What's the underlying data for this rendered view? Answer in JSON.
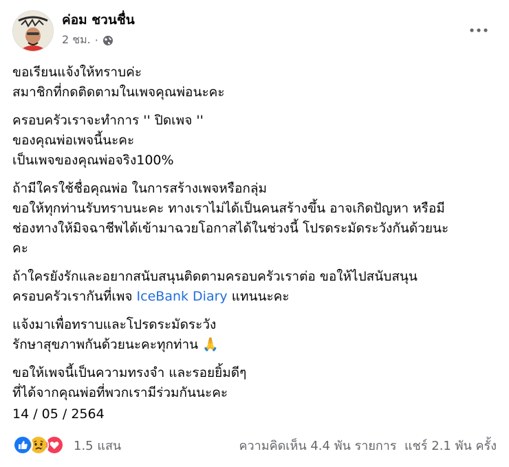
{
  "post": {
    "author": "ค่อม ชวนชื่น",
    "time": "2 ชม.",
    "privacy_icon": "globe-icon",
    "paragraphs": [
      [
        "ขอเรียนแจ้งให้ทราบค่ะ",
        "สมาชิกที่กดติดตามในเพจคุณพ่อนะคะ"
      ],
      [
        "ครอบครัวเราจะทำการ '' ปิดเพจ ''",
        "ของคุณพ่อเพจนี้นะคะ",
        "เป็นเพจของคุณพ่อจริง100%"
      ],
      [
        "ถ้ามีใครใช้ชื่อคุณพ่อ ในการสร้างเพจหรือกลุ่ม",
        "ขอให้ทุกท่านรับทราบนะคะ ทางเราไม่ได้เป็นคนสร้างขึ้น อาจเกิดปัญหา หรือมี",
        "ช่องทางให้มิจฉาชีพได้เข้ามาฉวยโอกาสได้ในช่วงนี้ โปรดระมัดระวังกันด้วยนะ",
        "คะ"
      ],
      {
        "line1": "ถ้าใครยังรักและอยากสนับสนุนติดตามครอบครัวเราต่อ ขอให้ไปสนับสนุน",
        "line2_before": "ครอบครัวเรากันที่เพจ ",
        "link_text": "IceBank Diary",
        "line2_after": "  แทนนะคะ"
      },
      [
        "แจ้งมาเพื่อทราบและโปรดระมัดระวัง",
        "รักษาสุขภาพกันด้วยนะคะทุกท่าน"
      ],
      [
        "ขอให้เพจนี้เป็นความทรงจำ และรอยยิ้มดีๆ",
        "ที่ได้จากคุณพ่อที่พวกเรามีร่วมกันนะคะ"
      ]
    ],
    "date": "14 / 05 / 2564",
    "pray_emoji": "🙏",
    "link_color": "#216fdb"
  },
  "footer": {
    "reactions": [
      "like-icon",
      "sad-icon",
      "love-icon"
    ],
    "reaction_count": "1.5 แสน",
    "comments": "ความคิดเห็น 4.4 พัน รายการ",
    "shares": "แชร์ 2.1 พัน ครั้ง"
  },
  "colors": {
    "text": "#050505",
    "secondary": "#65676b",
    "like": "#1877f2",
    "love": "#f33e58",
    "sad": "#f7b928"
  }
}
